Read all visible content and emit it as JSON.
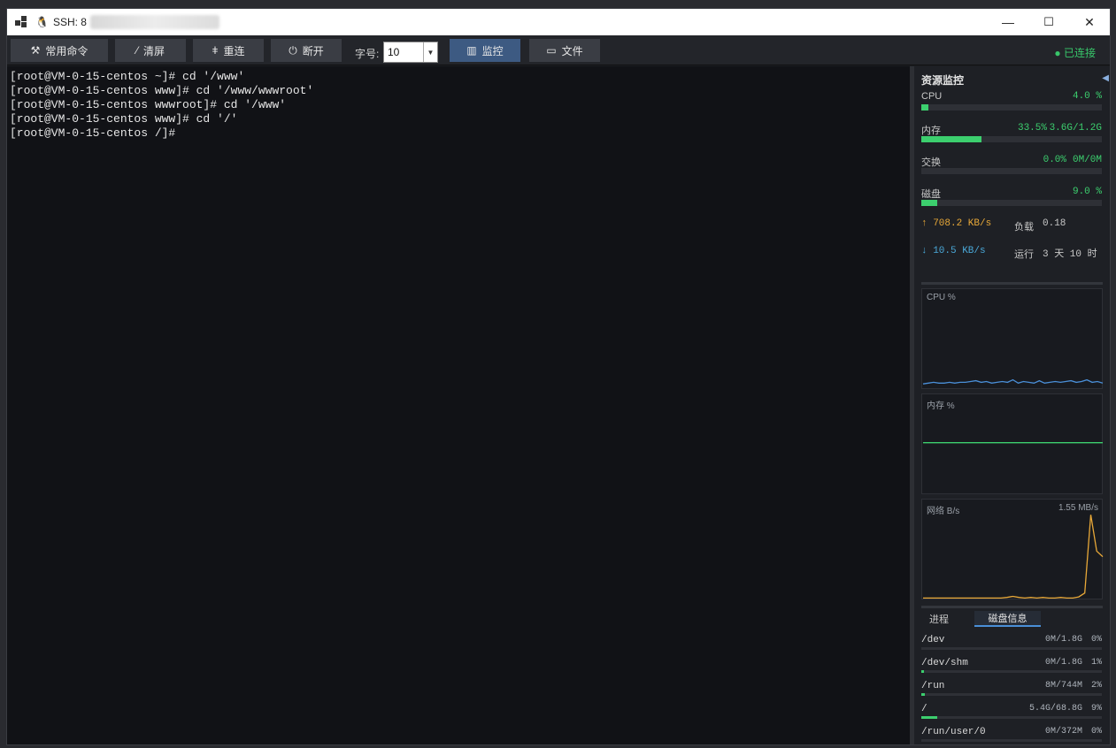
{
  "window": {
    "title": "SSH: 8",
    "minimize": "—",
    "maximize": "☐",
    "close": "✕"
  },
  "toolbar": {
    "commands_label": "常用命令",
    "clear_label": "清屏",
    "reconnect_label": "重连",
    "disconnect_label": "断开",
    "font_size_label": "字号:",
    "font_size_value": "10",
    "monitor_label": "监控",
    "files_label": "文件",
    "status": "● 已连接"
  },
  "terminal": {
    "lines": [
      "[root@VM-0-15-centos ~]# cd '/www'",
      "[root@VM-0-15-centos www]# cd '/www/wwwroot'",
      "[root@VM-0-15-centos wwwroot]# cd '/www'",
      "[root@VM-0-15-centos www]# cd '/'",
      "[root@VM-0-15-centos /]#"
    ]
  },
  "panel": {
    "title": "资源监控",
    "collapse_icon": "◀",
    "cpu": {
      "label": "CPU",
      "percent": "4.0 %",
      "fraction": 0.04
    },
    "mem": {
      "label": "内存",
      "percent": "33.5%",
      "detail": "3.6G/1.2G",
      "fraction": 0.335
    },
    "swap": {
      "label": "交换",
      "percent": "0.0%",
      "detail": "0M/0M",
      "fraction": 0.0
    },
    "disk": {
      "label": "磁盘",
      "percent": "9.0 %",
      "fraction": 0.09
    },
    "net_up": "↑ 708.2 KB/s",
    "net_down": "↓ 10.5 KB/s",
    "load_label": "负载",
    "load_value": "0.18",
    "uptime_label": "运行",
    "uptime_value": "3 天 10 时",
    "cpu_chart_title": "CPU %",
    "mem_chart_title": "内存 %",
    "net_chart_title": "网络 B/s",
    "net_chart_max": "1.55 MB/s",
    "tab_process": "进程",
    "tab_disk": "磁盘信息",
    "disks": [
      {
        "mount": "/dev",
        "size": "0M/1.8G",
        "pct": "0%",
        "fraction": 0.0
      },
      {
        "mount": "/dev/shm",
        "size": "0M/1.8G",
        "pct": "1%",
        "fraction": 0.01
      },
      {
        "mount": "/run",
        "size": "8M/744M",
        "pct": "2%",
        "fraction": 0.02
      },
      {
        "mount": "/",
        "size": "5.4G/68.8G",
        "pct": "9%",
        "fraction": 0.09
      },
      {
        "mount": "/run/user/0",
        "size": "0M/372M",
        "pct": "0%",
        "fraction": 0.0
      }
    ]
  },
  "colors": {
    "accent_green": "#3ccf6e",
    "cpu_line": "#4a8fd8",
    "mem_line": "#3ccf6e",
    "net_line": "#e8a838"
  },
  "chart_data": [
    {
      "type": "line",
      "title": "CPU %",
      "ylim": [
        0,
        100
      ],
      "values": [
        3,
        4,
        5,
        4,
        4,
        5,
        4,
        5,
        5,
        6,
        7,
        5,
        6,
        4,
        5,
        6,
        5,
        8,
        4,
        6,
        5,
        4,
        7,
        4,
        5,
        6,
        5,
        6,
        7,
        5,
        6,
        8,
        5,
        6,
        4
      ]
    },
    {
      "type": "line",
      "title": "内存 %",
      "ylim": [
        0,
        100
      ],
      "values": [
        33.5,
        33.5,
        33.5,
        33.5,
        33.5,
        33.5,
        33.5,
        33.5,
        33.5,
        33.5,
        33.5,
        33.5,
        33.5,
        33.5,
        33.5
      ]
    },
    {
      "type": "line",
      "title": "网络 B/s",
      "ylim": [
        0,
        1.55
      ],
      "values": [
        0.01,
        0.01,
        0.01,
        0.01,
        0.01,
        0.01,
        0.01,
        0.01,
        0.01,
        0.01,
        0.01,
        0.01,
        0.01,
        0.01,
        0.02,
        0.04,
        0.02,
        0.01,
        0.02,
        0.01,
        0.02,
        0.01,
        0.01,
        0.02,
        0.01,
        0.01,
        0.03,
        0.1,
        1.5,
        0.85,
        0.75
      ]
    }
  ]
}
